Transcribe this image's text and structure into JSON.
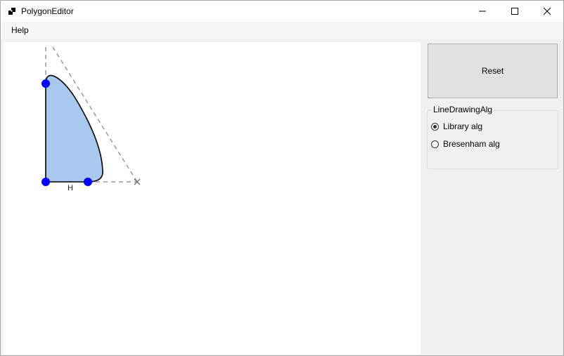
{
  "window": {
    "title": "PolygonEditor"
  },
  "titlebar": {
    "minimize_icon": "minimize-icon",
    "maximize_icon": "maximize-icon",
    "close_icon": "close-icon"
  },
  "menu": {
    "items": [
      {
        "label": "Help"
      }
    ]
  },
  "canvas": {
    "vertex_label": "H",
    "fill_color": "#a9c8f0",
    "vertex_color": "#0000ff",
    "guide_color": "#999999"
  },
  "sidebar": {
    "reset_label": "Reset",
    "group_title": "LineDrawingAlg",
    "options": [
      {
        "label": "Library alg",
        "checked": true
      },
      {
        "label": "Bresenham alg",
        "checked": false
      }
    ]
  }
}
